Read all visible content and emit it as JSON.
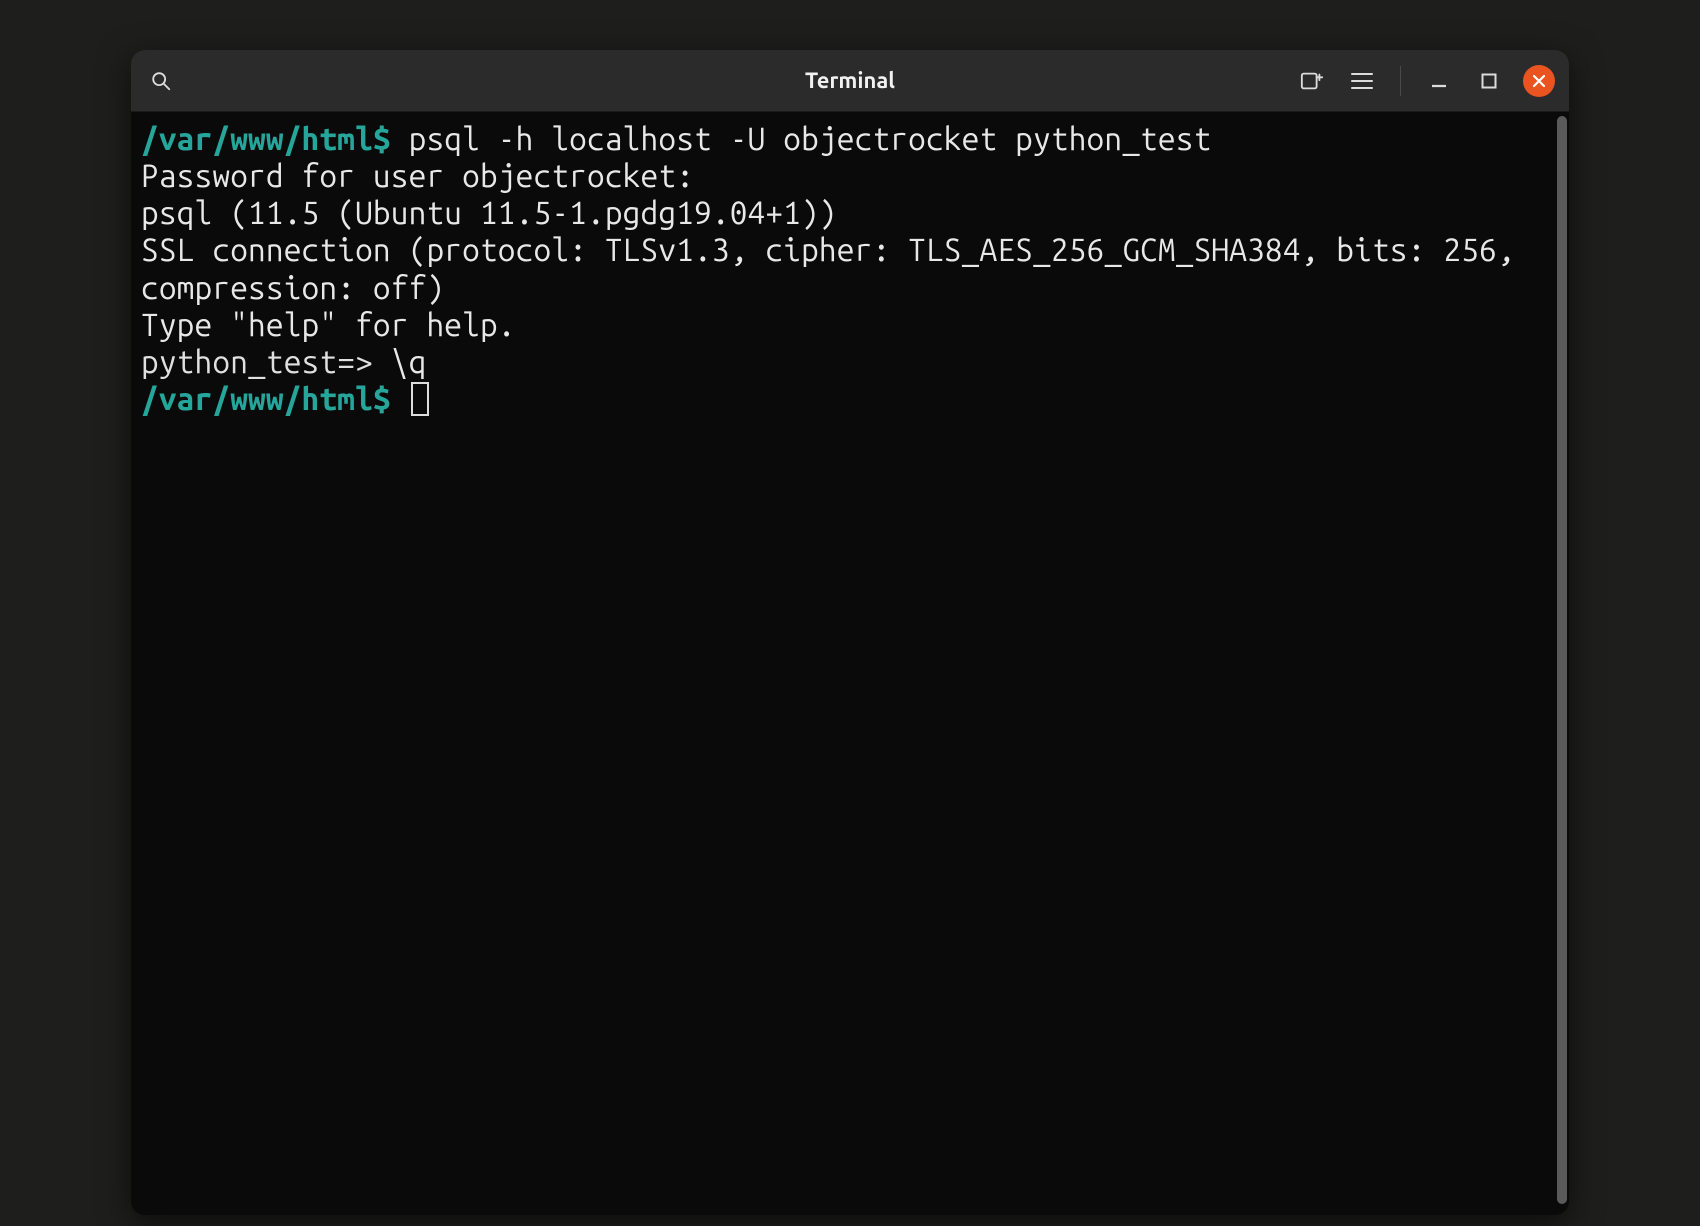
{
  "window": {
    "title": "Terminal"
  },
  "icons": {
    "search": "search-icon",
    "newTab": "new-tab-icon",
    "menu": "hamburger-menu-icon",
    "minimize": "minimize-icon",
    "maximize": "maximize-icon",
    "close": "close-icon"
  },
  "terminal": {
    "lines": [
      {
        "prompt": "/var/www/html",
        "dollar": "$",
        "cmd": " psql -h localhost -U objectrocket python_test"
      },
      {
        "text": "Password for user objectrocket:"
      },
      {
        "text": "psql (11.5 (Ubuntu 11.5-1.pgdg19.04+1))"
      },
      {
        "text": "SSL connection (protocol: TLSv1.3, cipher: TLS_AES_256_GCM_SHA384, bits: 256, compression: off)"
      },
      {
        "text": "Type \"help\" for help."
      },
      {
        "text": ""
      },
      {
        "psql_prompt": "python_test=>",
        "psql_cmd": " \\q"
      },
      {
        "prompt": "/var/www/html",
        "dollar": "$",
        "cursor": true
      }
    ]
  }
}
